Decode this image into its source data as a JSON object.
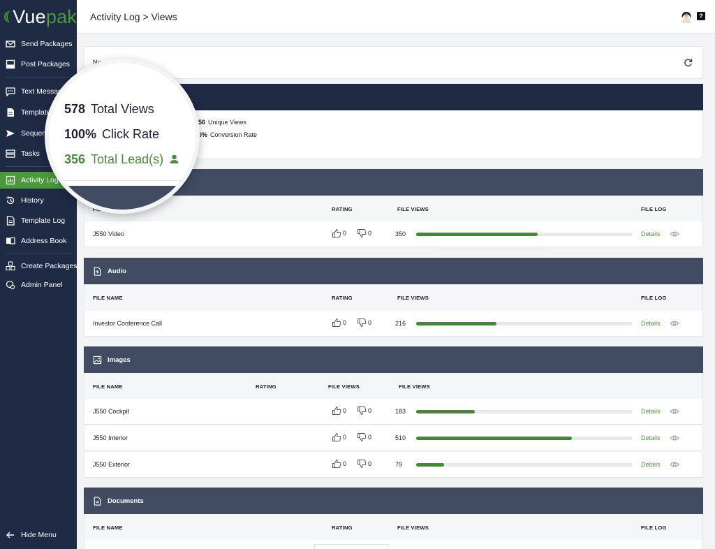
{
  "app": {
    "logo_prefix": "Vue",
    "logo_suffix": "pak",
    "brand_accent": "#4b9b3a",
    "sidebar_bg": "#1f2a44"
  },
  "sidebar": {
    "items": [
      {
        "label": "Send Packages",
        "icon": "envelope-icon"
      },
      {
        "label": "Post Packages",
        "icon": "post-icon"
      },
      {
        "label": "Text Messages",
        "icon": "chat-icon"
      },
      {
        "label": "Templates",
        "icon": "document-icon"
      },
      {
        "label": "Sequences",
        "icon": "send-icon"
      },
      {
        "label": "Tasks",
        "icon": "tasks-icon"
      },
      {
        "label": "Activity Log",
        "icon": "chart-icon"
      },
      {
        "label": "History",
        "icon": "history-icon"
      },
      {
        "label": "Template Log",
        "icon": "template-log-icon"
      },
      {
        "label": "Address Book",
        "icon": "book-icon"
      },
      {
        "label": "Create Packages",
        "icon": "boxes-icon"
      },
      {
        "label": "Admin Panel",
        "icon": "admin-icon"
      }
    ],
    "hide_menu": "Hide Menu"
  },
  "header": {
    "breadcrumb": "Activity Log > Views",
    "help": "?"
  },
  "name_card": {
    "label": "Na"
  },
  "stats": {
    "unique_views_value": "56",
    "unique_views_label": "Unique Views",
    "conversion_value": "0%",
    "conversion_label": "Conversion Rate"
  },
  "magnifier": {
    "total_views_value": "578",
    "total_views_label": "Total Views",
    "click_rate_value": "100%",
    "click_rate_label": "Click Rate",
    "leads_value": "356",
    "leads_label": "Total Lead(s)"
  },
  "video": {
    "columns": {
      "file_name": "FILE NAME",
      "rating": "RATING",
      "file_views": "FILE VIEWS",
      "file_log": "FILE LOG"
    },
    "rows": [
      {
        "name": "J550 Video",
        "up": "0",
        "down": "0",
        "views": "350",
        "fraction": 0.56,
        "details": "Details"
      }
    ]
  },
  "audio": {
    "title": "Audio",
    "columns": {
      "file_name": "FILE NAME",
      "rating": "RATING",
      "file_views": "FILE VIEWS",
      "file_log": "FILE LOG"
    },
    "rows": [
      {
        "name": "Investor Conference Call",
        "up": "0",
        "down": "0",
        "views": "216",
        "fraction": 0.37,
        "details": "Details"
      }
    ]
  },
  "images": {
    "title": "Images",
    "columns": {
      "file_name": "FILE NAME",
      "rating": "RATING",
      "file_views_1": "FILE VIEWS",
      "file_views_2": "FILE VIEWS"
    },
    "rows": [
      {
        "name": "J550 Cockpit",
        "up": "0",
        "down": "0",
        "views": "183",
        "fraction": 0.27,
        "details": "Details"
      },
      {
        "name": "J550 Interior",
        "up": "0",
        "down": "0",
        "views": "510",
        "fraction": 0.72,
        "details": "Details"
      },
      {
        "name": "J550 Exterior",
        "up": "0",
        "down": "0",
        "views": "79",
        "fraction": 0.13,
        "details": "Details"
      }
    ]
  },
  "documents": {
    "title": "Documents",
    "columns": {
      "file_name": "FILE NAME",
      "rating": "RATING",
      "file_views": "FILE VIEWS",
      "file_log": "FILE LOG"
    }
  }
}
